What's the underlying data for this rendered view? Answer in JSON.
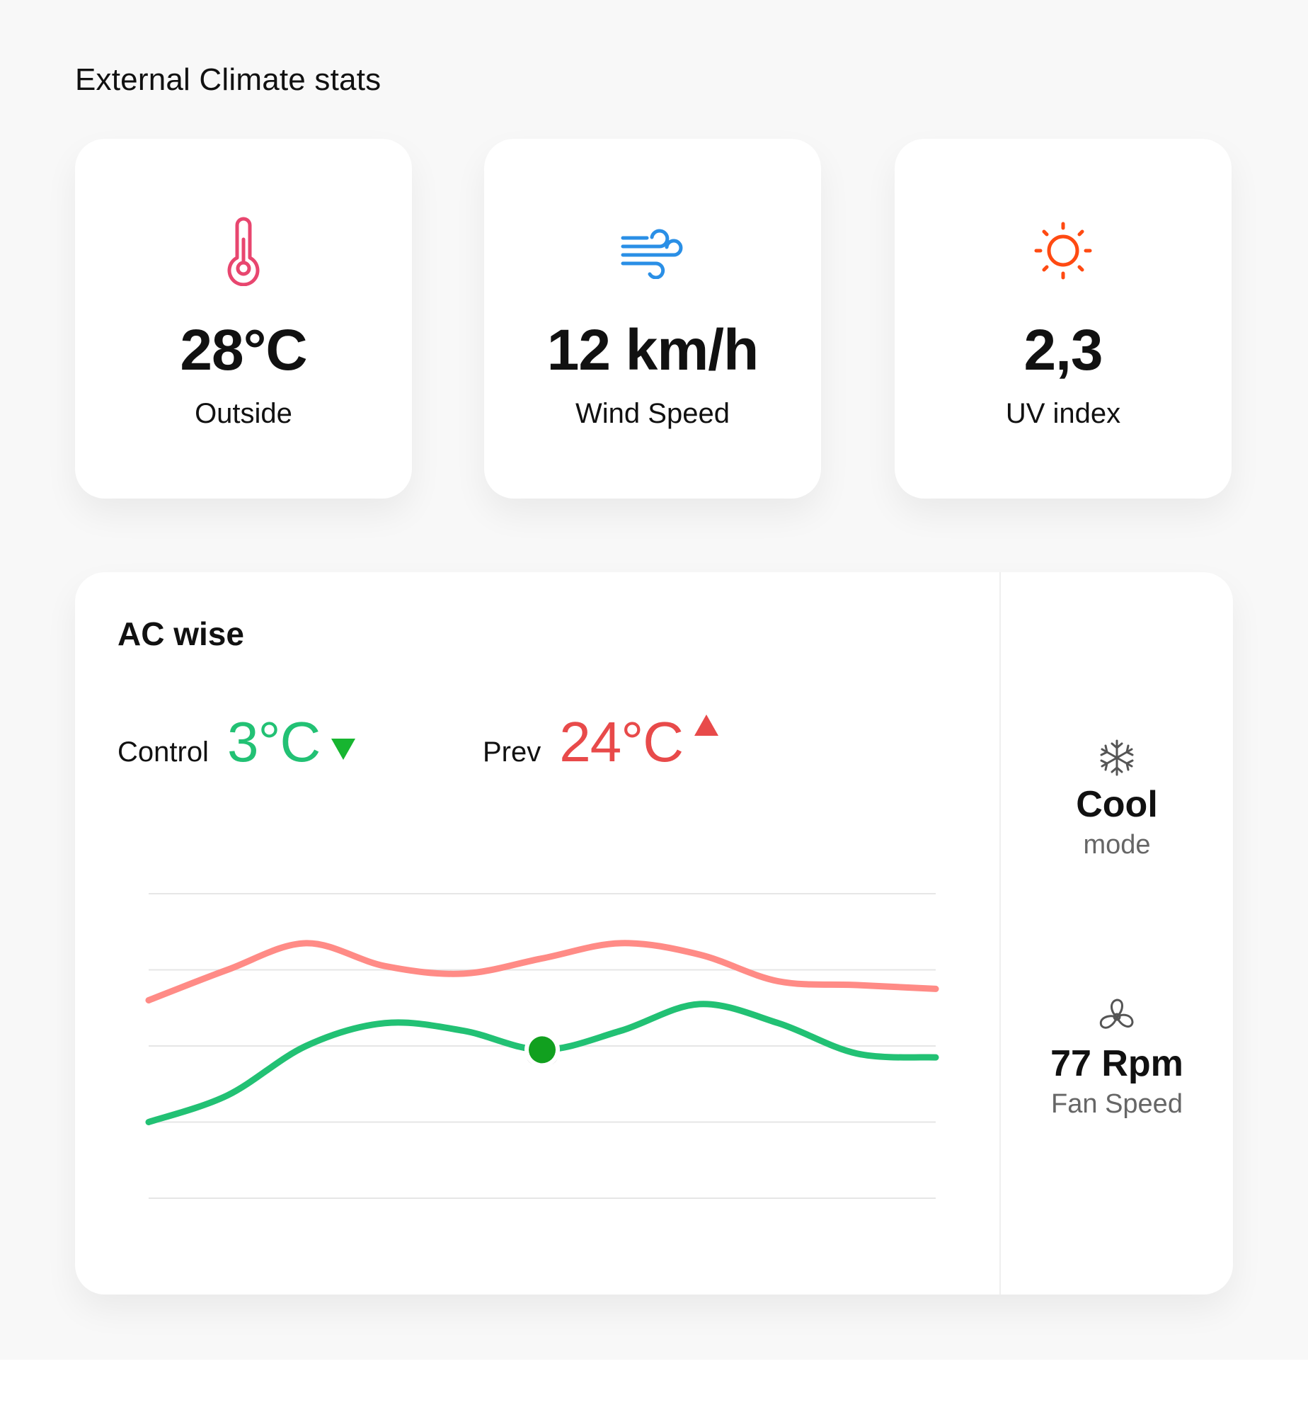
{
  "header": {
    "title": "External Climate stats"
  },
  "stats": [
    {
      "value": "28°C",
      "label": "Outside",
      "icon": "thermometer-icon",
      "color": "#e8466f"
    },
    {
      "value": "12 km/h",
      "label": "Wind Speed",
      "icon": "wind-icon",
      "color": "#2a8fe6"
    },
    {
      "value": "2,3",
      "label": "UV index",
      "icon": "sun-icon",
      "color": "#ff4a12"
    }
  ],
  "ac": {
    "title": "AC wise",
    "control": {
      "label": "Control",
      "value": "3°C",
      "trend": "down",
      "color": "#22c174",
      "arrow_color": "#17b530"
    },
    "prev": {
      "label": "Prev",
      "value": "24°C",
      "trend": "up",
      "color": "#e84a4a"
    },
    "mode": {
      "value": "Cool",
      "label": "mode",
      "icon": "snowflake-icon"
    },
    "fan": {
      "value": "77 Rpm",
      "label": "Fan Speed",
      "icon": "fan-icon"
    }
  },
  "chart_data": {
    "type": "line",
    "x": [
      0,
      1,
      2,
      3,
      4,
      5,
      6,
      7,
      8,
      9,
      10
    ],
    "ylim": [
      0,
      4
    ],
    "grid": true,
    "legend": "none",
    "series": [
      {
        "values": [
          2.6,
          3.0,
          3.35,
          3.05,
          2.95,
          3.15,
          3.35,
          3.2,
          2.85,
          2.8,
          2.75
        ],
        "color": "#ff8b86"
      },
      {
        "values": [
          1.0,
          1.35,
          2.0,
          2.3,
          2.2,
          1.95,
          2.2,
          2.55,
          2.3,
          1.9,
          1.85
        ],
        "color": "#22c174"
      }
    ],
    "marker": {
      "series": 1,
      "x": 5,
      "y": 1.95,
      "color": "#11a01f"
    }
  }
}
